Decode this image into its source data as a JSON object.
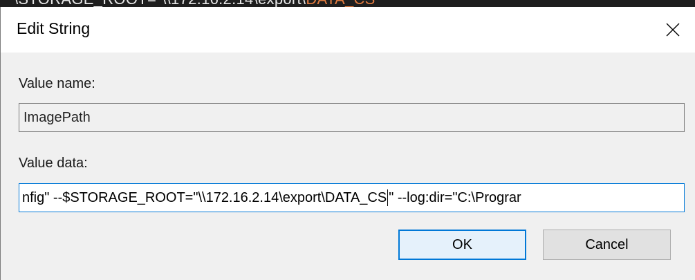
{
  "background_window": {
    "path_prefix": "\\STORAGE_ROOT=\"\\\\172.16.2.14\\export\\",
    "path_suffix": "DATA_CS"
  },
  "dialog": {
    "title": "Edit String",
    "close_icon": "close-icon"
  },
  "value_name": {
    "label": "Value name:",
    "value": "ImagePath"
  },
  "value_data": {
    "label": "Value data:",
    "value_before_caret": "nfig\" --$STORAGE_ROOT=\"\\\\172.16.2.14\\export\\DATA_CS",
    "value_after_caret": "\" --log:dir=\"C:\\Prograr"
  },
  "buttons": {
    "ok": "OK",
    "cancel": "Cancel"
  },
  "colors": {
    "accent": "#0078d7",
    "dialog_bg": "#f0f0f0",
    "bg_window_text_accent": "#e07a3f"
  }
}
